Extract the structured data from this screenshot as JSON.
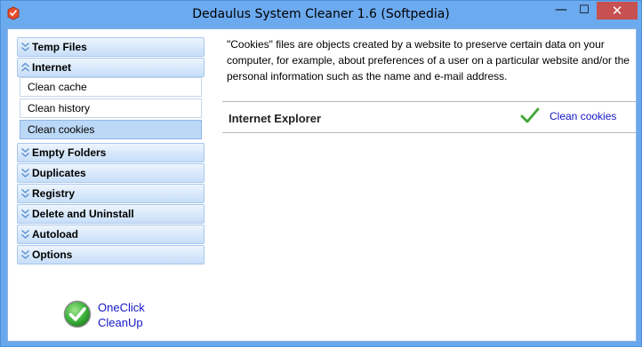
{
  "window": {
    "title": "Dedaulus System Cleaner  1.6   (Softpedia)",
    "controls": {
      "minimize": "—",
      "maximize": "☐",
      "close": "✕"
    }
  },
  "colors": {
    "titlebar": "#6caaf0",
    "close_button": "#c75050",
    "link": "#1515c8",
    "selected_item": "#bcd8f7"
  },
  "sidebar": {
    "headers": [
      {
        "label": "Temp Files",
        "expanded": false
      },
      {
        "label": "Internet",
        "expanded": true
      },
      {
        "label": "Empty Folders",
        "expanded": false
      },
      {
        "label": "Duplicates",
        "expanded": false
      },
      {
        "label": "Registry",
        "expanded": false
      },
      {
        "label": "Delete and Uninstall",
        "expanded": false
      },
      {
        "label": "Autoload",
        "expanded": false
      },
      {
        "label": "Options",
        "expanded": false
      }
    ],
    "internet_items": [
      {
        "label": "Clean cache",
        "selected": false
      },
      {
        "label": "Clean history",
        "selected": false
      },
      {
        "label": "Clean cookies",
        "selected": true
      }
    ],
    "oneclick": {
      "line1": "OneClick",
      "line2": "CleanUp",
      "icon": "green-check-circle-icon"
    }
  },
  "content": {
    "description": "\"Cookies\" files are objects created by a website to preserve certain data on your computer, for example, about preferences of a user on a particular website and/or the personal information such as the name and e-mail address.",
    "section_title": "Internet Explorer",
    "action_label": "Clean cookies",
    "action_icon": "green-checkmark-icon"
  }
}
